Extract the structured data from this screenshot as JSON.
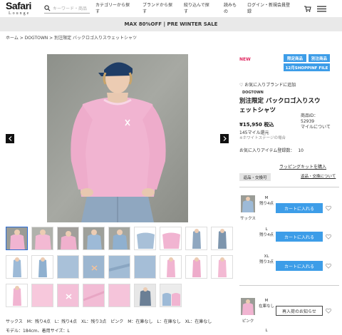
{
  "header": {
    "logo_main": "Safari",
    "logo_sub": "Lounge",
    "search_placeholder": "キーワード・商品",
    "nav": [
      {
        "line1": "カテゴリーから探",
        "line2": "す"
      },
      {
        "line1": "ブランドから探",
        "line2": "す"
      },
      {
        "line1": "絞り込んで探",
        "line2": "す"
      },
      {
        "line1": "読みも",
        "line2": "の"
      },
      {
        "line1": "ログイン・新規会員登",
        "line2": "録"
      }
    ]
  },
  "banner": {
    "text": "MAX 80%OFF | PRE WINTER SALE"
  },
  "breadcrumb": {
    "text": "ホーム > DOGTOWN > 別注限定 バックロゴ入りスウェットシャツ"
  },
  "product": {
    "new_label": "NEW",
    "tags": [
      "限定商品",
      "別注商品",
      "12月SHOPPINF FILE"
    ],
    "brand_fav": "♡ お気に入りブランドに追加",
    "brand": "DOGTOWN",
    "title": "別注限定 バックロゴ入りスウェットシャツ",
    "price": "¥15,950 税込",
    "miles": "145マイル還元",
    "miles_note": "※ホワイトステージの場合",
    "product_id_label": "商品ID：",
    "product_id": "52939",
    "miles_about": "マイルについて",
    "fav_count_text": "お気に入りアイテム登録数：",
    "fav_count": "10",
    "kit_link": "ラッピングキットを購入",
    "returns_label": "返品・交換可",
    "returns_link": "返品・交換について"
  },
  "variants": [
    {
      "color": "サックス",
      "rows": [
        {
          "size": "M",
          "stock": "残り4点",
          "button": "カートに入れる"
        },
        {
          "size": "L",
          "stock": "残り4点",
          "button": "カートに入れる"
        },
        {
          "size": "XL",
          "stock": "残り3点",
          "button": "カートに入れる"
        }
      ]
    },
    {
      "color": "ピンク",
      "rows": [
        {
          "size": "M",
          "stock": "在庫なし",
          "button": "再入荷のお知らせ"
        },
        {
          "size": "L",
          "stock": "",
          "button": ""
        }
      ]
    }
  ],
  "info": {
    "stock_line": "サックス　M：残り4点　L：残り4点　XL：残り3点　ピンク　M：在庫なし　L：在庫なし　XL：在庫なし",
    "model_line": "モデル：184cm、着用サイズ：L"
  },
  "colors": {
    "accent_blue": "#3d9de8",
    "new_pink": "#e0245e",
    "banner_bg": "#e9e9e9",
    "selected_border": "#2a6bd6"
  },
  "icons": [
    "search-icon",
    "cart-icon",
    "menu-icon",
    "chevron-left-icon",
    "chevron-right-icon",
    "heart-icon"
  ]
}
